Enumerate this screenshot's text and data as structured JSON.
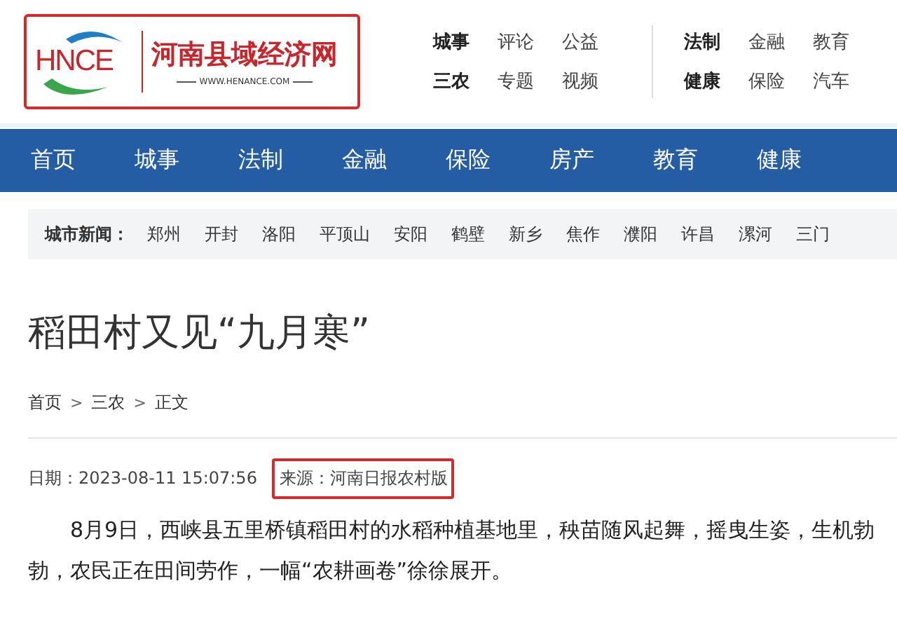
{
  "logo": {
    "mark": "HNCE",
    "name": "河南县域经济网",
    "url": "WWW.HENANCE.COM",
    "highlighted": true
  },
  "top_links": [
    {
      "group": [
        {
          "label": "城事",
          "bold": true
        },
        {
          "label": "评论",
          "bold": false
        },
        {
          "label": "公益",
          "bold": false
        },
        {
          "label": "三农",
          "bold": true
        },
        {
          "label": "专题",
          "bold": false
        },
        {
          "label": "视频",
          "bold": false
        }
      ]
    },
    {
      "group": [
        {
          "label": "法制",
          "bold": true
        },
        {
          "label": "金融",
          "bold": false
        },
        {
          "label": "教育",
          "bold": false
        },
        {
          "label": "健康",
          "bold": true
        },
        {
          "label": "保险",
          "bold": false
        },
        {
          "label": "汽车",
          "bold": false
        }
      ]
    }
  ],
  "nav": [
    "首页",
    "城事",
    "法制",
    "金融",
    "保险",
    "房产",
    "教育",
    "健康"
  ],
  "city_news": {
    "label": "城市新闻：",
    "cities": [
      "郑州",
      "开封",
      "洛阳",
      "平顶山",
      "安阳",
      "鹤壁",
      "新乡",
      "焦作",
      "濮阳",
      "许昌",
      "漯河",
      "三门"
    ]
  },
  "article": {
    "title": "稻田村又见“九月寒”",
    "breadcrumb": [
      {
        "kind": "link",
        "text": "首页"
      },
      {
        "kind": "separator",
        "text": ">"
      },
      {
        "kind": "link",
        "text": "三农"
      },
      {
        "kind": "separator",
        "text": ">"
      },
      {
        "kind": "link",
        "text": "正文"
      }
    ],
    "date": "日期：2023-08-11 15:07:56",
    "source": {
      "text": "来源：河南日报农村版",
      "highlighted": true
    },
    "body": "8月9日，西峡县五里桥镇稻田村的水稻种植基地里，秧苗随风起舞，摇曳生姿，生机勃勃，农民正在田间劳作，一幅“农耕画卷”徐徐展开。"
  }
}
